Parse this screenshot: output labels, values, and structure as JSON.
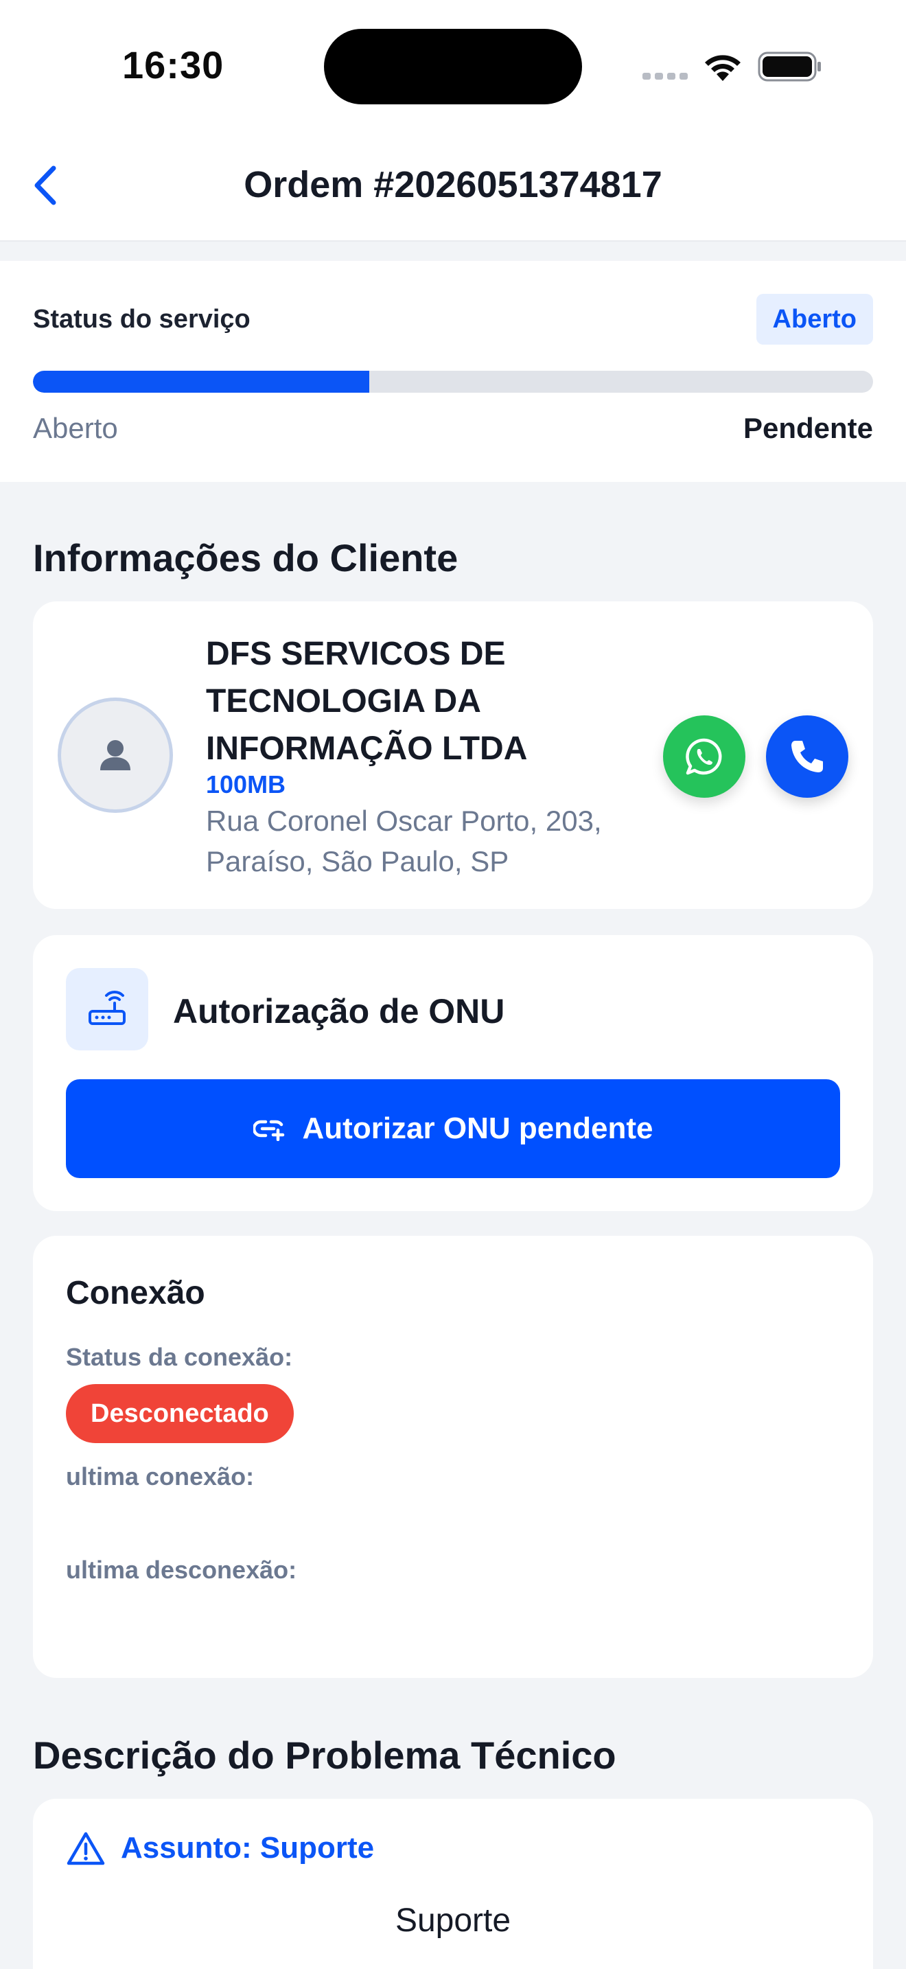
{
  "status_bar": {
    "time": "16:30"
  },
  "header": {
    "title": "Ordem #2026051374817"
  },
  "service_status": {
    "label": "Status do serviço",
    "badge": "Aberto",
    "progress_fraction": 0.4,
    "progress_start": "Aberto",
    "progress_end": "Pendente",
    "accent": "#0b55f6"
  },
  "client_section": {
    "title": "Informações do Cliente",
    "name": "DFS SERVICOS DE TECNOLOGIA DA INFORMAÇÃO LTDA",
    "plan": "100MB",
    "address": "Rua Coronel Oscar Porto, 203, Paraíso, São Paulo, SP",
    "whatsapp_color": "#25c35b",
    "phone_color": "#0b55f6"
  },
  "onu": {
    "title": "Autorização de ONU",
    "button_label": "Autorizar ONU pendente",
    "icon": "router-icon"
  },
  "connection": {
    "title": "Conexão",
    "status_label": "Status da conexão:",
    "status_value": "Desconectado",
    "status_color": "#f04438",
    "last_connection_label": "ultima conexão:",
    "last_disconnection_label": "ultima desconexão:"
  },
  "problem_section": {
    "title": "Descrição do Problema Técnico",
    "subject_label": "Assunto: Suporte",
    "subject_text": "Suporte",
    "icon": "warning-icon"
  }
}
